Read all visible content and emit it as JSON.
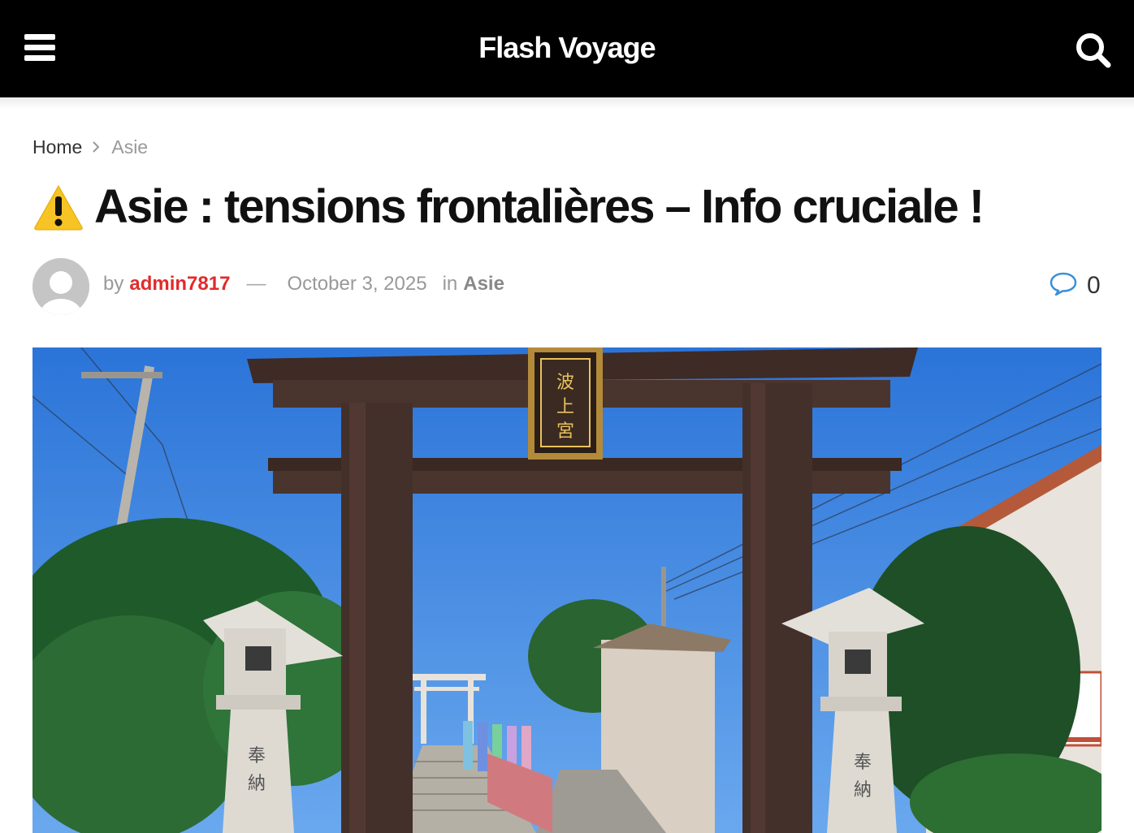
{
  "site": {
    "logo": "Flash Voyage"
  },
  "header": {
    "menu_icon": "hamburger-icon",
    "search_icon": "search-icon"
  },
  "breadcrumb": {
    "home": "Home",
    "current": "Asie",
    "separator_icon": "chevron-right-icon"
  },
  "article": {
    "title": "Asie : tensions frontalières – Info cruciale !",
    "title_icon": "warning-icon",
    "by_label": "by",
    "author": "admin7817",
    "separator": "—",
    "date": "October 3, 2025",
    "in_label": "in",
    "category": "Asie",
    "comment_count": "0",
    "comment_icon": "comment-bubble-icon",
    "hero_sign_text": "波上宮",
    "lantern_text_left": "奉納",
    "lantern_text_right": "奉納"
  },
  "colors": {
    "header_bg": "#000000",
    "author": "#e02b2b",
    "comment_icon": "#3a8fd9",
    "sky": "#2f7fe0"
  }
}
